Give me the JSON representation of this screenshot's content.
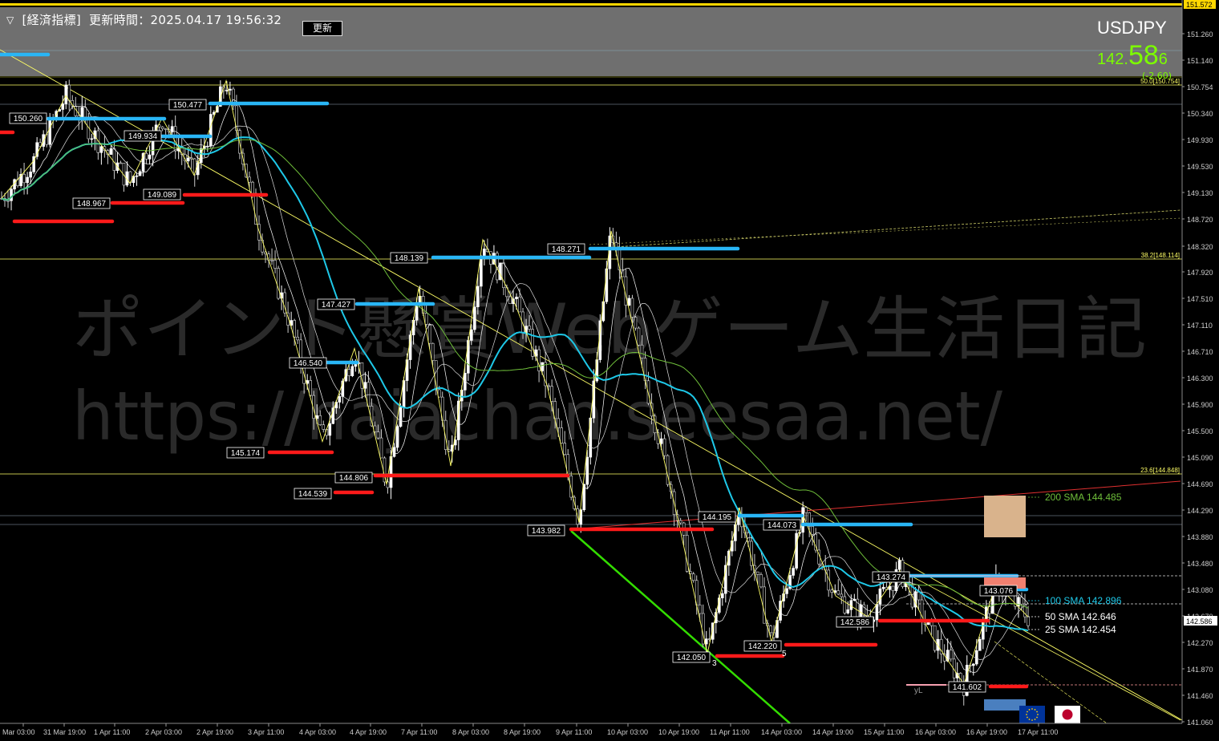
{
  "header": {
    "menu_label": "[経済指標]",
    "update_time": "更新時間：2025.04.17 19:56:32",
    "update_button": "更新"
  },
  "symbol": "USDJPY",
  "quote": {
    "int": "142.",
    "big": "58",
    "last": "6",
    "change": "(-2.60)"
  },
  "watermark": {
    "line1": "ポイント懸賞Webゲーム生活日記",
    "line2": "https://hajachan.seesaa.net/"
  },
  "colors": {
    "up_level": "#29b6f6",
    "down_level": "#ff0000",
    "sma100": "#1ec8e8",
    "sma200": "#6fbf3a",
    "fib": "#ffff66",
    "price_green": "#7CFC00",
    "header_bg": "#6f6f6f"
  },
  "price_axis": [
    "151.572",
    "151.260",
    "151.140",
    "150.754",
    "150.340",
    "149.930",
    "149.530",
    "149.130",
    "148.720",
    "148.320",
    "147.920",
    "147.510",
    "147.110",
    "146.710",
    "146.300",
    "145.900",
    "145.500",
    "145.090",
    "144.690",
    "144.290",
    "143.880",
    "143.480",
    "143.080",
    "142.670",
    "142.586",
    "142.270",
    "141.870",
    "141.460",
    "141.060"
  ],
  "time_axis": [
    "Mar 03:00",
    "31 Mar 19:00",
    "1 Apr 11:00",
    "2 Apr 03:00",
    "2 Apr 19:00",
    "3 Apr 11:00",
    "4 Apr 03:00",
    "4 Apr 19:00",
    "7 Apr 11:00",
    "8 Apr 03:00",
    "8 Apr 19:00",
    "9 Apr 11:00",
    "10 Apr 03:00",
    "10 Apr 19:00",
    "11 Apr 11:00",
    "14 Apr 03:00",
    "14 Apr 19:00",
    "15 Apr 11:00",
    "16 Apr 03:00",
    "16 Apr 19:00",
    "17 Apr 11:00"
  ],
  "fib_levels": [
    {
      "label": "50.0[150.754]",
      "price": 150.754
    },
    {
      "label": "38.2[148.114]",
      "price": 148.114
    },
    {
      "label": "23.6[144.848]",
      "price": 144.848
    }
  ],
  "sma_labels": [
    {
      "text": "200 SMA 144.485",
      "color": "#6fbf3a",
      "price": 144.485
    },
    {
      "text": "100 SMA 142.896",
      "color": "#1ec8e8",
      "price": 142.896
    },
    {
      "text": "50 SMA 142.646",
      "color": "#ffffff",
      "price": 142.646
    },
    {
      "text": "25 SMA 142.454",
      "color": "#ffffff",
      "price": 142.454
    }
  ],
  "swing_labels": [
    {
      "text": "150.260",
      "kind": "high",
      "price": 150.26
    },
    {
      "text": "150.477",
      "kind": "high",
      "price": 150.477
    },
    {
      "text": "149.934",
      "kind": "high",
      "price": 149.934
    },
    {
      "text": "148.967",
      "kind": "low",
      "price": 148.967
    },
    {
      "text": "149.089",
      "kind": "low",
      "price": 149.089
    },
    {
      "text": "148.139",
      "kind": "high",
      "price": 148.139
    },
    {
      "text": "148.271",
      "kind": "high",
      "price": 148.271
    },
    {
      "text": "147.427",
      "kind": "high",
      "price": 147.427
    },
    {
      "text": "146.540",
      "kind": "high",
      "price": 146.54
    },
    {
      "text": "145.174",
      "kind": "low",
      "price": 145.174
    },
    {
      "text": "144.806",
      "kind": "low",
      "price": 144.806
    },
    {
      "text": "144.539",
      "kind": "low",
      "price": 144.539
    },
    {
      "text": "143.982",
      "kind": "low",
      "price": 143.982
    },
    {
      "text": "144.195",
      "kind": "high",
      "price": 144.195
    },
    {
      "text": "144.073",
      "kind": "high",
      "price": 144.073
    },
    {
      "text": "143.274",
      "kind": "high",
      "price": 143.274
    },
    {
      "text": "143.076",
      "kind": "high",
      "price": 143.076
    },
    {
      "text": "142.586",
      "kind": "low",
      "price": 142.586
    },
    {
      "text": "142.220",
      "kind": "low",
      "price": 142.22
    },
    {
      "text": "142.050",
      "kind": "low",
      "price": 142.05
    },
    {
      "text": "141.602",
      "kind": "low",
      "price": 141.602
    }
  ],
  "wave_labels": [
    "3",
    "5",
    "yL"
  ],
  "current_price": "142.586",
  "chart_data": {
    "type": "candlestick",
    "symbol": "USDJPY",
    "ylim": [
      141.06,
      151.572
    ],
    "close_path": [
      [
        0,
        148.75
      ],
      [
        1,
        149.3
      ],
      [
        2,
        150.26
      ],
      [
        3,
        149.6
      ],
      [
        4,
        148.97
      ],
      [
        5,
        149.93
      ],
      [
        6,
        149.09
      ],
      [
        7,
        150.48
      ],
      [
        8,
        148.3
      ],
      [
        9,
        146.9
      ],
      [
        10,
        145.17
      ],
      [
        11,
        146.54
      ],
      [
        12,
        144.54
      ],
      [
        13,
        147.43
      ],
      [
        14,
        144.81
      ],
      [
        15,
        148.14
      ],
      [
        16,
        147.2
      ],
      [
        17,
        146.0
      ],
      [
        18,
        143.98
      ],
      [
        19,
        148.27
      ],
      [
        20,
        146.2
      ],
      [
        21,
        144.2
      ],
      [
        22,
        142.05
      ],
      [
        23,
        144.2
      ],
      [
        24,
        142.22
      ],
      [
        25,
        144.07
      ],
      [
        26,
        142.9
      ],
      [
        27,
        142.59
      ],
      [
        28,
        143.27
      ],
      [
        29,
        142.3
      ],
      [
        30,
        141.6
      ],
      [
        31,
        143.08
      ],
      [
        32,
        142.59
      ]
    ]
  }
}
